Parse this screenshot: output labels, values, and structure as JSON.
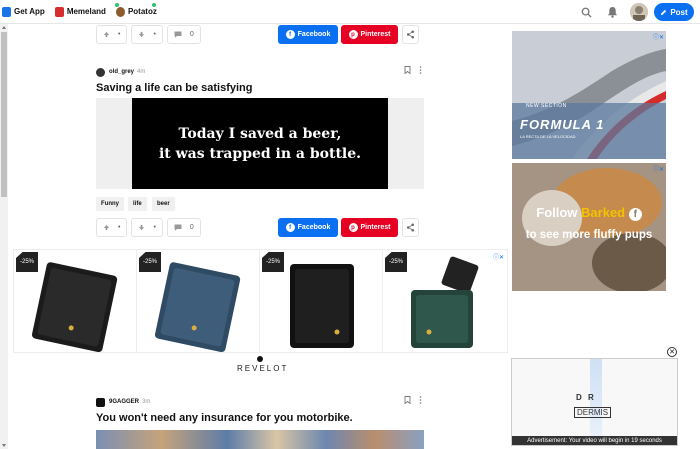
{
  "topbar": {
    "items": [
      {
        "label": "Get App",
        "icon": "phone-icon",
        "color": "#1a73e8"
      },
      {
        "label": "Memeland",
        "icon": "flag-icon",
        "color": "#d32f2f"
      },
      {
        "label": "Potatoz",
        "icon": "potato-icon",
        "color": "#8d5a2b"
      }
    ],
    "post_label": "Post"
  },
  "post1": {
    "actions": {
      "up": "•",
      "down": "•",
      "comments": "0"
    },
    "facebook_label": "Facebook",
    "pinterest_label": "Pinterest"
  },
  "post2": {
    "author": "old_grey",
    "age": "4m",
    "title": "Saving a life can be satisfying",
    "image_text_line1": "Today I saved a beer,",
    "image_text_line2": "it was trapped in a bottle.",
    "tags": [
      "Funny",
      "life",
      "beer"
    ],
    "actions": {
      "up": "•",
      "down": "•",
      "comments": "0"
    },
    "facebook_label": "Facebook",
    "pinterest_label": "Pinterest"
  },
  "ad_row": {
    "badges": [
      "-25%",
      "-25%",
      "-25%",
      "-25%"
    ],
    "brand": "REVELOT"
  },
  "post3": {
    "author": "9GAGGER",
    "age": "3m",
    "title": "You won't need any insurance for you motorbike."
  },
  "side_ads": {
    "f1_small": "NEW SECTION",
    "f1_title": "FORMULA 1",
    "f1_sub": "LA RECTA DE LA VELOCIDAD",
    "barked_line1": "Follow ",
    "barked_brand": "Barked",
    "barked_line2": "to see more fluffy pups"
  },
  "video_ad": {
    "logo_top": "D R",
    "logo_bottom": "DERMIS",
    "caption": "Advertisement: Your video will begin in 19 seconds"
  },
  "colors": {
    "accent": "#0a6ff0",
    "pinterest": "#e60023"
  }
}
